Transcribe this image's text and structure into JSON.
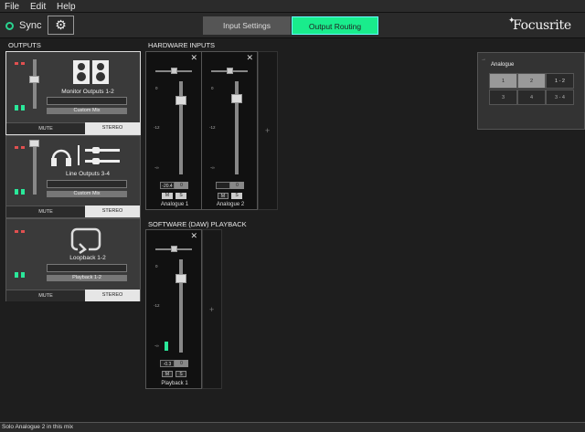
{
  "menubar": {
    "items": [
      "File",
      "Edit",
      "Help"
    ]
  },
  "toolbar": {
    "sync_label": "Sync",
    "tabs": [
      {
        "label": "Input Settings",
        "active": false
      },
      {
        "label": "Output Routing",
        "active": true
      }
    ],
    "brand": "Focusrite"
  },
  "outputs": {
    "heading": "OUTPUTS",
    "channels": [
      {
        "name": "Monitor Outputs 1-2",
        "mix": "Custom Mix",
        "mute_label": "MUTE",
        "stereo_label": "STEREO"
      },
      {
        "name": "Line Outputs 3-4",
        "mix": "Custom Mix",
        "mute_label": "MUTE",
        "stereo_label": "STEREO"
      },
      {
        "name": "Loopback 1-2",
        "mix": "Playback 1-2",
        "mute_label": "MUTE",
        "stereo_label": "STEREO"
      }
    ]
  },
  "hardware_inputs": {
    "heading": "HARDWARE INPUTS",
    "strips": [
      {
        "name": "Analogue 1",
        "gain": "-20.4",
        "pan": "0",
        "m": "M",
        "s": "S"
      },
      {
        "name": "Analogue 2",
        "gain": "",
        "pan": "0",
        "m": "M",
        "s": "S"
      }
    ]
  },
  "software_playback": {
    "heading": "SOFTWARE (DAW) PLAYBACK",
    "strips": [
      {
        "name": "Playback 1",
        "gain": "-0.3",
        "pan": "0",
        "m": "M",
        "s": "S"
      }
    ]
  },
  "scale_labels": [
    "0",
    "-12",
    "-∞"
  ],
  "right_panel": {
    "title": "Analogue",
    "row1": [
      "1",
      "2",
      "1 - 2"
    ],
    "row2": [
      "3",
      "4",
      "3 - 4"
    ]
  },
  "status": {
    "text": "Solo Analogue 2 in this mix"
  },
  "colors": {
    "accent": "#19ec8c",
    "led_red": "#e05050",
    "led_green": "#2ae89a"
  }
}
